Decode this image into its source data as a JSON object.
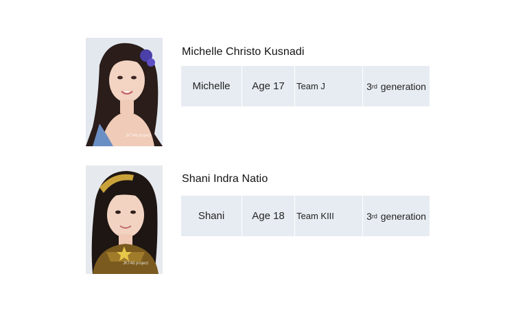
{
  "members": [
    {
      "full_name": "Michelle Christo Kusnadi",
      "nickname": "Michelle",
      "age": "Age  17",
      "team": "Team J",
      "gen_number": "3",
      "gen_suffix": "rd",
      "gen_label": "generation",
      "watermark": "JKT48 project"
    },
    {
      "full_name": "Shani Indra Natio",
      "nickname": "Shani",
      "age": "Age 18",
      "team": "Team KIII",
      "gen_number": "3",
      "gen_suffix": "rd",
      "gen_label": "generation",
      "watermark": "JKT48 project"
    }
  ]
}
